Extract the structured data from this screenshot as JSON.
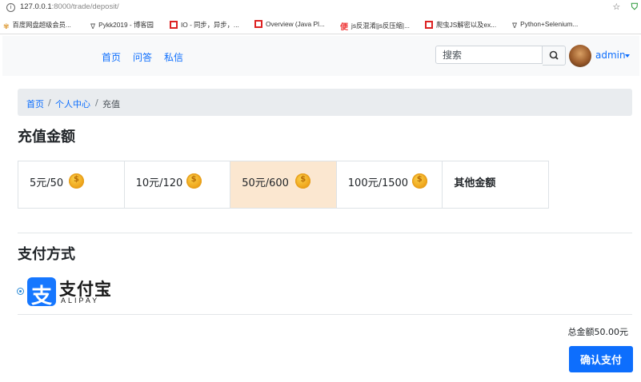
{
  "browser": {
    "url_host": "127.0.0.1",
    "url_port_path": ":8000/trade/deposit/",
    "bookmarks": [
      {
        "label": "百度网盘超级会员...",
        "icon": "butterfly-icon"
      },
      {
        "label": "Pykk2019 - 博客园",
        "icon": "fish-icon"
      },
      {
        "label": "IO - 同步，异步，...",
        "icon": "c-red-icon"
      },
      {
        "label": "Overview (Java Pl...",
        "icon": "page-red-icon"
      },
      {
        "label": "js反混淆|js反压缩|...",
        "icon": "bian-icon"
      },
      {
        "label": "爬虫JS解密以及ex...",
        "icon": "c-red-icon"
      },
      {
        "label": "Python+Selenium...",
        "icon": "fish-icon"
      }
    ]
  },
  "nav": {
    "links": [
      "首页",
      "问答",
      "私信"
    ],
    "search_placeholder": "搜索",
    "username": "admin"
  },
  "breadcrumb": [
    "首页",
    "个人中心",
    "充值"
  ],
  "amount_section": {
    "title": "充值金额",
    "options": [
      {
        "label": "5元/50",
        "coin": true,
        "selected": false
      },
      {
        "label": "10元/120",
        "coin": true,
        "selected": false
      },
      {
        "label": "50元/600",
        "coin": true,
        "selected": true
      },
      {
        "label": "100元/1500",
        "coin": true,
        "selected": false
      },
      {
        "label": "其他金额",
        "coin": false,
        "selected": false
      }
    ]
  },
  "payment_section": {
    "title": "支付方式",
    "method": {
      "logo_char": "支",
      "name": "支付宝",
      "sub": "ALIPAY"
    }
  },
  "total_text": "总金额50.00元",
  "confirm_label": "确认支付",
  "colors": {
    "accent": "#0d6efd",
    "selected_bg": "#fbe7d0",
    "alipay_blue": "#1677ff"
  }
}
